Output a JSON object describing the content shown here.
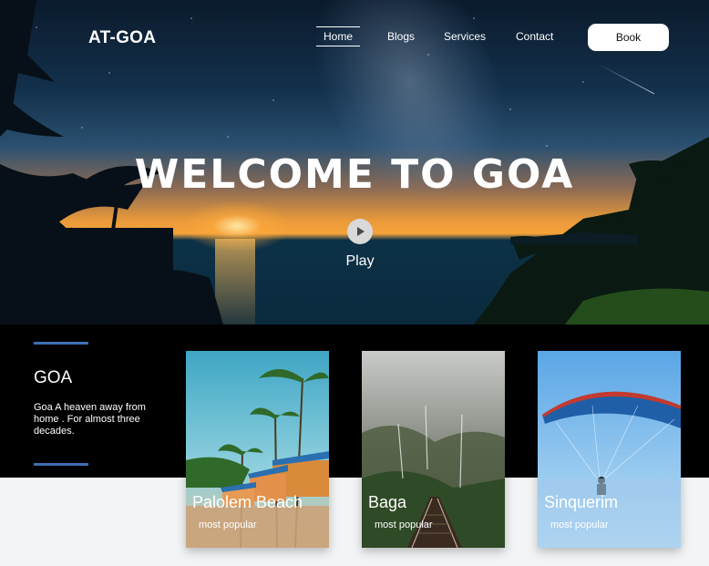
{
  "header": {
    "logo": "AT-GOA",
    "nav": [
      "Home",
      "Blogs",
      "Services",
      "Contact"
    ],
    "book_label": "Book"
  },
  "hero": {
    "title": "WELCOME TO GOA",
    "play_label": "Play"
  },
  "intro": {
    "heading": "GOA",
    "description": "Goa A heaven away from home . For almost three decades."
  },
  "cards": [
    {
      "title": "Palolem Beach",
      "subtitle": "most popular"
    },
    {
      "title": "Baga",
      "subtitle": "most popular"
    },
    {
      "title": "Sinquerim",
      "subtitle": "most popular"
    }
  ],
  "colors": {
    "accent_line": "#3e6fb4",
    "band_background": "#000000",
    "page_background": "#f2f4f5"
  },
  "icons": {
    "play": "play-icon"
  }
}
